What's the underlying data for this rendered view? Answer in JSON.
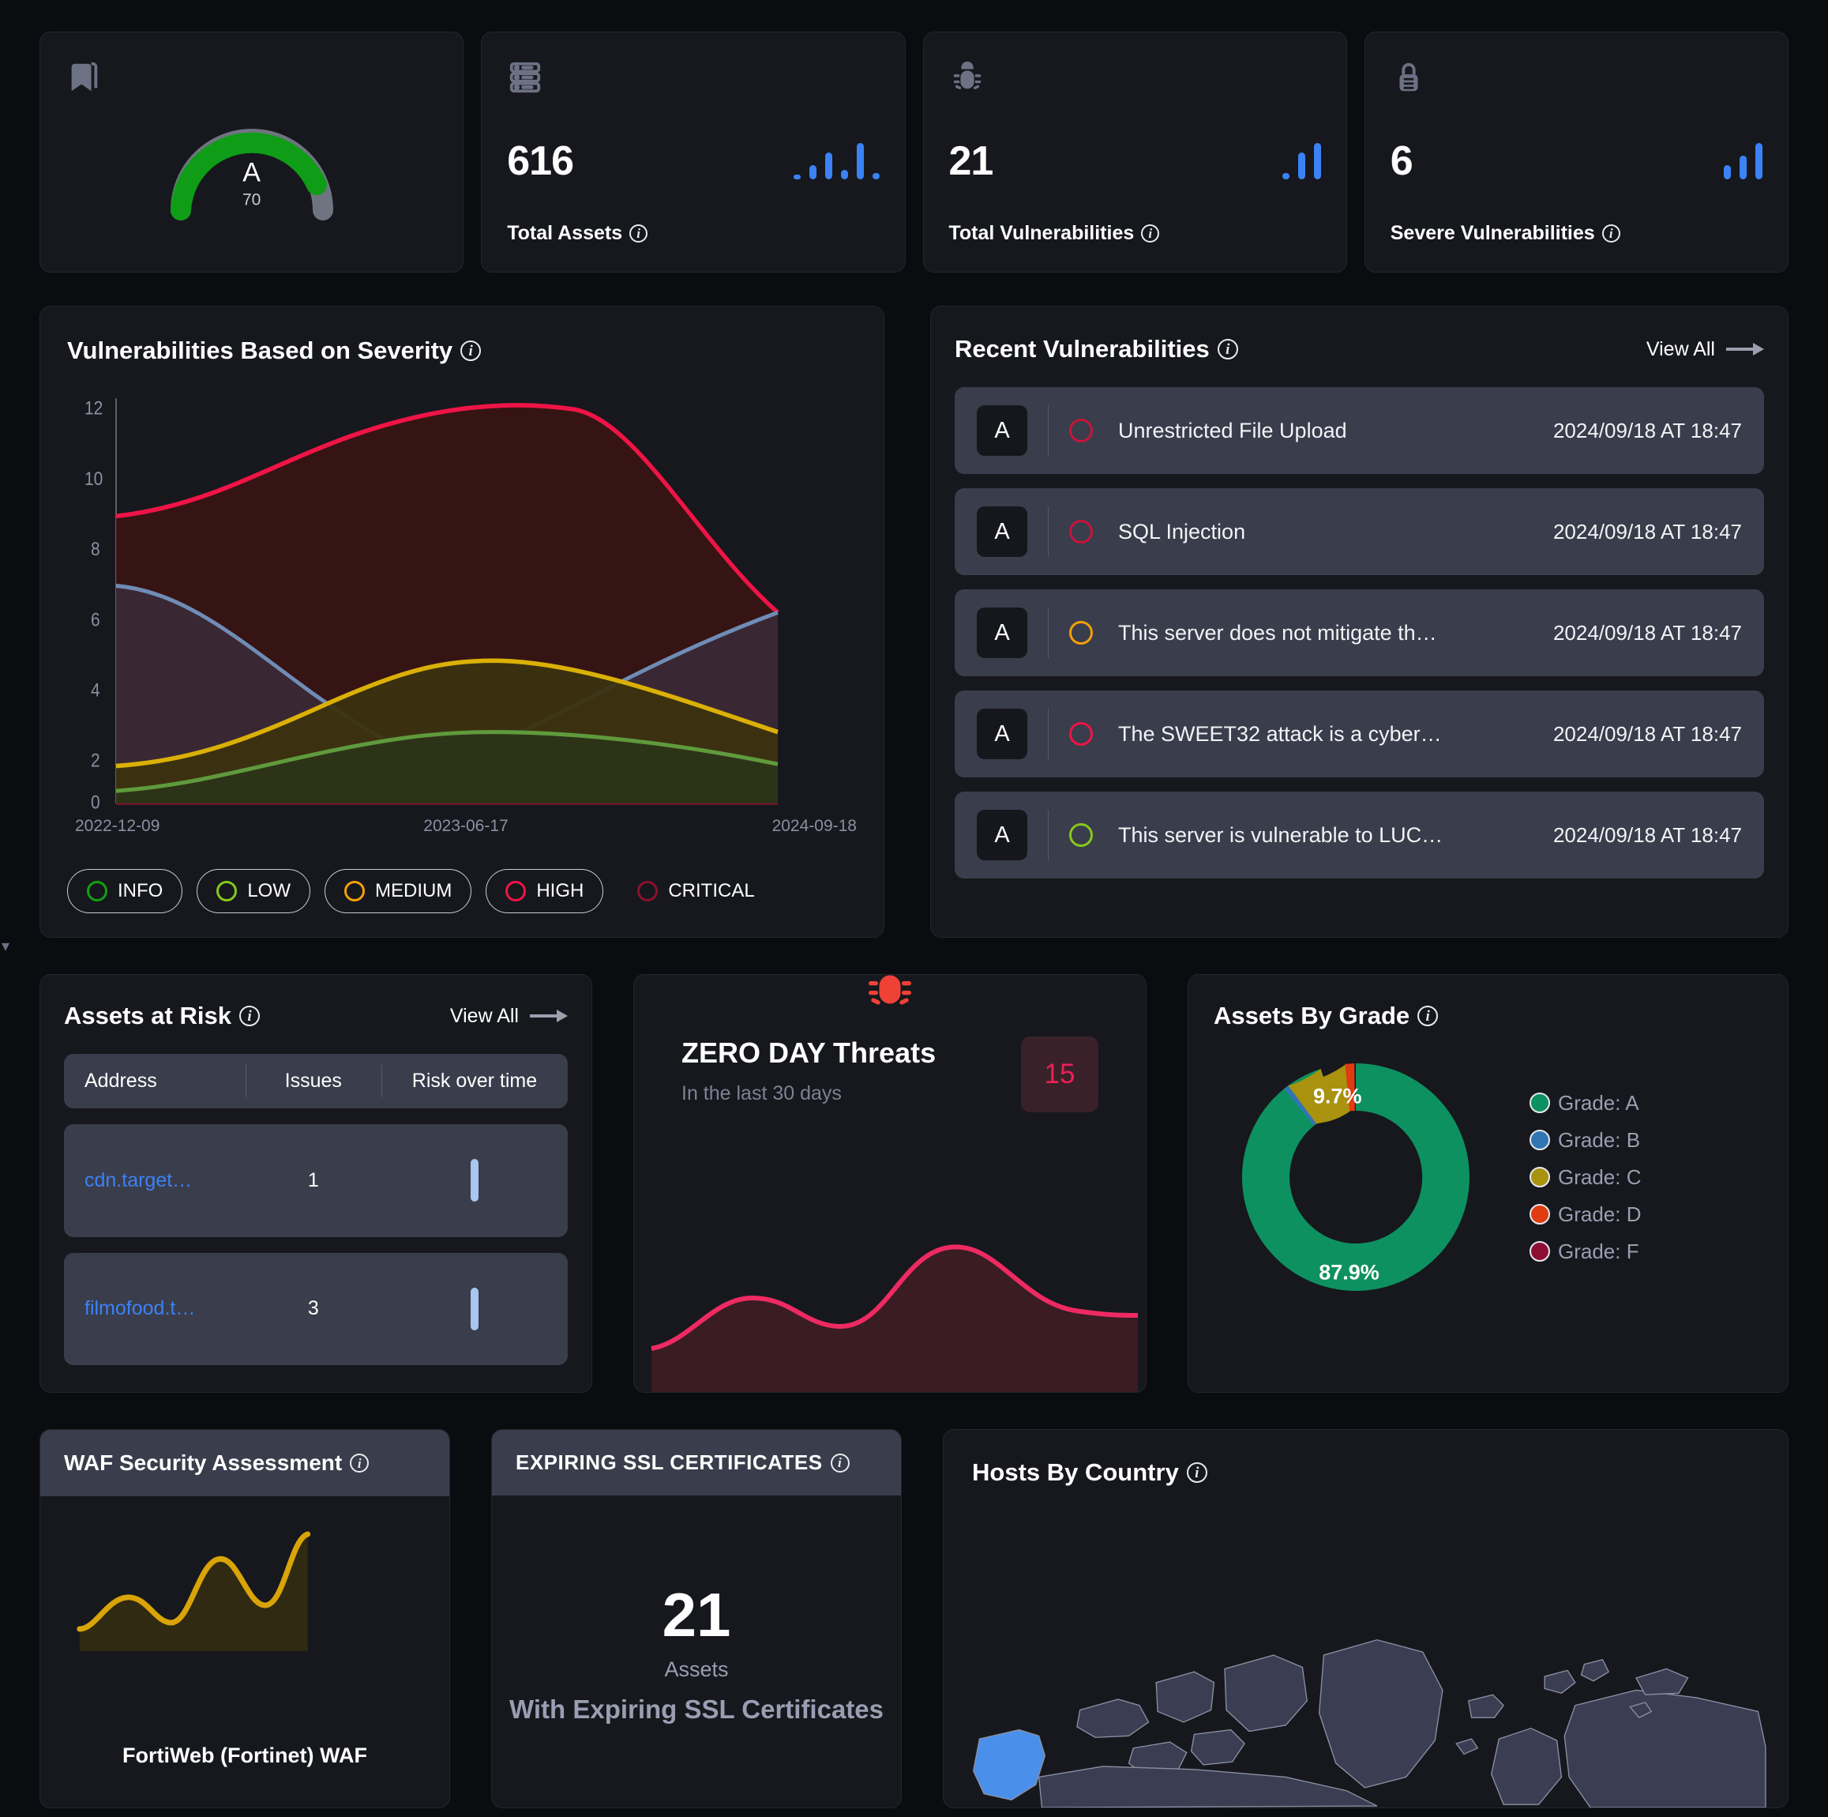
{
  "grade_gauge": {
    "icon": "bookmark-icon",
    "grade": "A",
    "score": "70",
    "arc_color": "#0f9d17",
    "track_color": "#6f7480"
  },
  "kpis": [
    {
      "icon": "server-icon",
      "value": "616",
      "label": "Total Assets",
      "bars": [
        6,
        18,
        34,
        12,
        46,
        8
      ],
      "bar_color": "#3b82f6"
    },
    {
      "icon": "bug-icon",
      "value": "21",
      "label": "Total Vulnerabilities",
      "bars": [
        8,
        34,
        46
      ],
      "bar_color": "#3b82f6"
    },
    {
      "icon": "lock-icon",
      "value": "6",
      "label": "Severe Vulnerabilities",
      "bars": [
        18,
        30,
        46
      ],
      "bar_color": "#3b82f6"
    }
  ],
  "severity_panel": {
    "title": "Vulnerabilities Based on Severity",
    "x_labels": [
      "2022-12-09",
      "2023-06-17",
      "2024-09-18"
    ],
    "legend": [
      {
        "label": "INFO",
        "color": "#12a012",
        "active": true
      },
      {
        "label": "LOW",
        "color": "#86c91b",
        "active": true
      },
      {
        "label": "MEDIUM",
        "color": "#f2a007",
        "active": true
      },
      {
        "label": "HIGH",
        "color": "#f01446",
        "active": true
      },
      {
        "label": "CRITICAL",
        "color": "#8c1030",
        "active": false
      }
    ]
  },
  "chart_data": [
    {
      "type": "area",
      "title": "Vulnerabilities Based on Severity",
      "xlabel": "",
      "ylabel": "",
      "x": [
        "2022-12-09",
        "2023-06-17",
        "2024-09-18"
      ],
      "ytick_labels": [
        "0",
        "2",
        "4",
        "6",
        "8",
        "10",
        "12"
      ],
      "ylim": [
        0,
        12.8
      ],
      "grid": false,
      "legend_position": "bottom",
      "series": [
        {
          "name": "HIGH",
          "color": "#f01446",
          "values": [
            9.0,
            9.5,
            11.2,
            12.0,
            11.8,
            8.0,
            5.0
          ]
        },
        {
          "name": "CRITICAL",
          "color": "#8a7fa0",
          "values": [
            7.0,
            6.6,
            5.0,
            3.0,
            2.0,
            3.2,
            5.0
          ]
        },
        {
          "name": "MEDIUM",
          "color": "#dbb006",
          "values": [
            2.0,
            2.2,
            3.4,
            4.8,
            5.0,
            4.2,
            3.0
          ]
        },
        {
          "name": "LOW",
          "color": "#5f9a3c",
          "values": [
            1.0,
            1.6,
            2.6,
            3.0,
            3.0,
            2.6,
            2.2
          ]
        }
      ]
    },
    {
      "type": "area",
      "title": "ZERO DAY Threats",
      "ylim": [
        0,
        10
      ],
      "values": [
        2.0,
        2.4,
        4.6,
        4.2,
        3.4,
        3.6,
        7.6,
        9.0,
        6.6,
        5.4,
        5.2
      ],
      "color": "#ee2a62"
    },
    {
      "type": "area",
      "title": "WAF Security Assessment",
      "ylim": [
        0,
        10
      ],
      "values": [
        1.0,
        2.2,
        4.6,
        4.4,
        3.0,
        2.6,
        6.8,
        8.2,
        5.2,
        4.6,
        7.0,
        9.4
      ],
      "color": "#d9a407"
    },
    {
      "type": "pie",
      "title": "Assets By Grade",
      "labels": [
        "Grade: A",
        "Grade: B",
        "Grade: C",
        "Grade: D",
        "Grade: F"
      ],
      "values": [
        87.9,
        0.7,
        9.7,
        1.7,
        0.0
      ],
      "colors": [
        "#0d9160",
        "#3175b3",
        "#a8920e",
        "#e03b11",
        "#8c0e34"
      ],
      "data_labels": [
        "87.9%",
        "",
        "9.7%",
        "",
        ""
      ],
      "legend_position": "right"
    }
  ],
  "recent_panel": {
    "title": "Recent Vulnerabilities",
    "view_all": "View All",
    "items": [
      {
        "grade": "A",
        "severity_color": "#c8143c",
        "title": "Unrestricted File Upload",
        "time": "2024/09/18 AT 18:47"
      },
      {
        "grade": "A",
        "severity_color": "#c8143c",
        "title": "SQL Injection",
        "time": "2024/09/18 AT 18:47"
      },
      {
        "grade": "A",
        "severity_color": "#f2a007",
        "title": "This server does not mitigate th…",
        "time": "2024/09/18 AT 18:47"
      },
      {
        "grade": "A",
        "severity_color": "#f01446",
        "title": "The SWEET32 attack is a cyber…",
        "time": "2024/09/18 AT 18:47"
      },
      {
        "grade": "A",
        "severity_color": "#86c91b",
        "title": "This server is vulnerable to LUC…",
        "time": "2024/09/18 AT 18:47"
      }
    ]
  },
  "assets_at_risk": {
    "title": "Assets at Risk",
    "view_all": "View All",
    "columns": [
      "Address",
      "Issues",
      "Risk over time"
    ],
    "rows": [
      {
        "address": "cdn.target…",
        "issues": "1"
      },
      {
        "address": "filmofood.t…",
        "issues": "3"
      }
    ]
  },
  "zero_day": {
    "icon": "bug-icon",
    "title": "ZERO DAY Threats",
    "subtitle": "In the last 30 days",
    "count": "15",
    "count_color": "#ec1f56"
  },
  "assets_by_grade": {
    "title": "Assets By Grade",
    "legend": [
      {
        "label": "Grade: A",
        "color": "#0d9160"
      },
      {
        "label": "Grade: B",
        "color": "#3175b3"
      },
      {
        "label": "Grade: C",
        "color": "#a8920e"
      },
      {
        "label": "Grade: D",
        "color": "#e03b11"
      },
      {
        "label": "Grade: F",
        "color": "#8c0e34"
      }
    ],
    "slice_labels": {
      "major": "87.9%",
      "minor": "9.7%"
    }
  },
  "waf": {
    "title": "WAF Security Assessment",
    "name": "FortiWeb (Fortinet) WAF"
  },
  "ssl": {
    "title": "EXPIRING SSL CERTIFICATES",
    "count": "21",
    "unit": "Assets",
    "description": "With Expiring SSL Certificates"
  },
  "hosts_by_country": {
    "title": "Hosts By Country",
    "highlight_color": "#4a90ea",
    "land_color": "#3b3e52"
  }
}
